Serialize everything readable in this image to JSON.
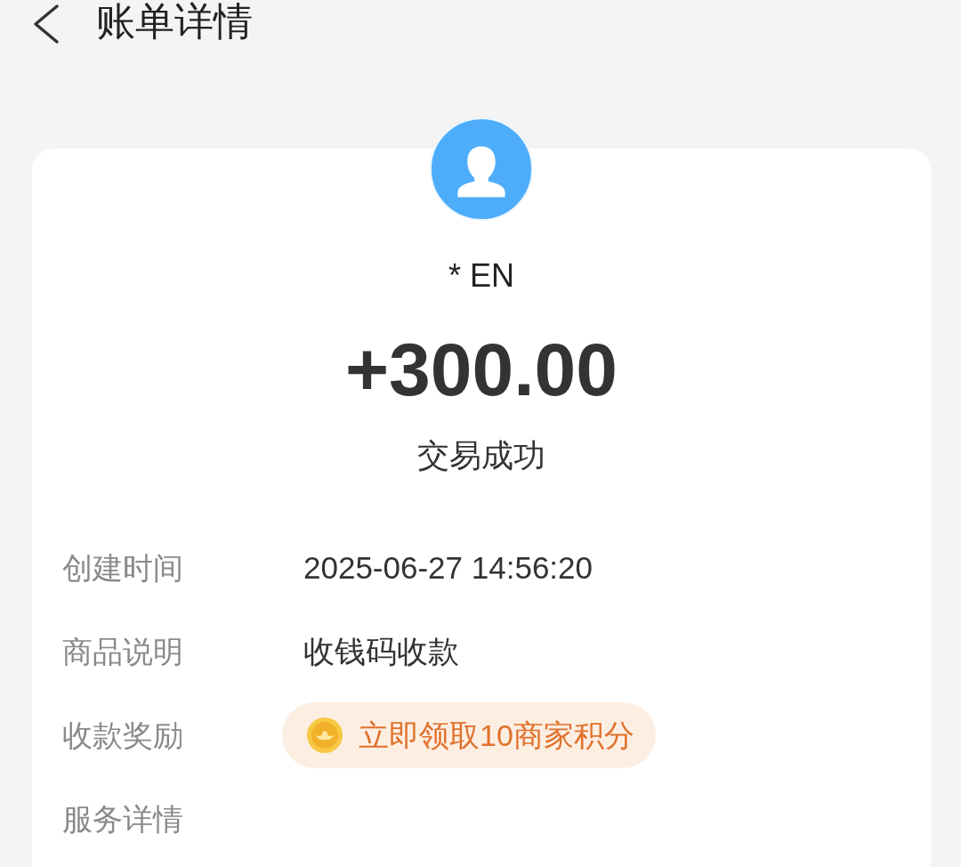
{
  "header": {
    "title": "账单详情"
  },
  "payer": {
    "name": "* EN"
  },
  "amount": "+300.00",
  "status": "交易成功",
  "details": [
    {
      "kind": "text",
      "label": "创建时间",
      "value": "2025-06-27 14:56:20"
    },
    {
      "kind": "text",
      "label": "商品说明",
      "value": "收钱码收款"
    },
    {
      "kind": "reward",
      "label": "收款奖励",
      "value": "立即领取10商家积分"
    },
    {
      "kind": "label",
      "label": "服务详情"
    }
  ]
}
